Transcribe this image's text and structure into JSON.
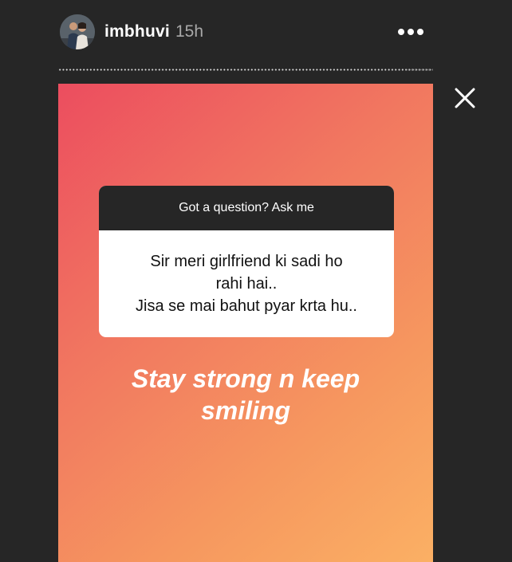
{
  "header": {
    "username": "imbhuvi",
    "timestamp": "15h",
    "more_icon": "more-horizontal-icon",
    "close_icon": "close-icon"
  },
  "question_sticker": {
    "prompt": "Got a question? Ask me",
    "question_lines": [
      "Sir meri girlfriend ki sadi ho",
      "rahi hai..",
      "Jisa se mai bahut pyar krta hu.."
    ]
  },
  "reply": {
    "lines": [
      "Stay strong n keep",
      "smiling"
    ]
  },
  "colors": {
    "background": "#262626",
    "gradient_start": "#ec4d5f",
    "gradient_end": "#fbb064",
    "username": "#ffffff",
    "timestamp": "#a8a8a8"
  }
}
